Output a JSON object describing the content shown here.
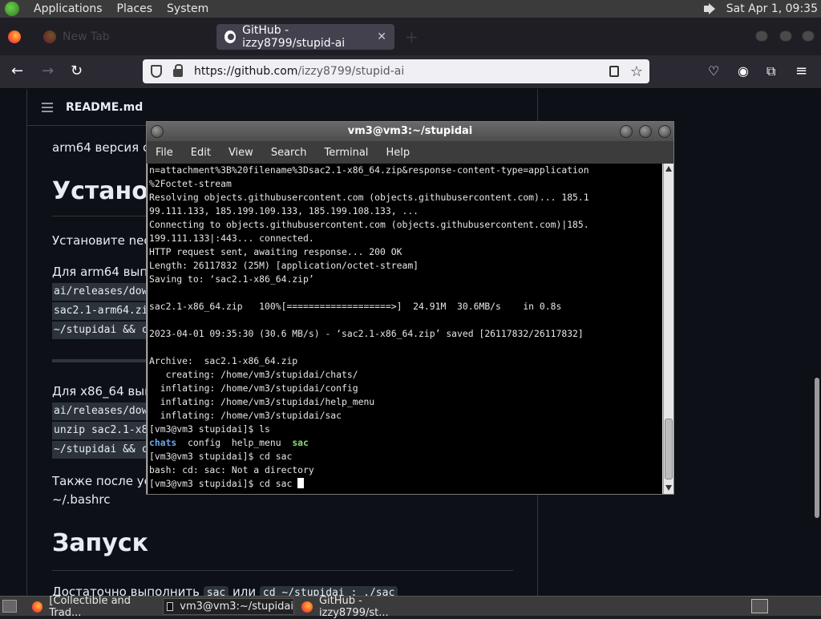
{
  "top_panel": {
    "menus": [
      "Applications",
      "Places",
      "System"
    ],
    "clock": "Sat Apr  1, 09:35"
  },
  "browser": {
    "tabs": [
      {
        "label": "",
        "active": false
      },
      {
        "label": "New Tab",
        "active": false
      },
      {
        "label": "GitHub - izzy8799/stupid-ai",
        "active": true
      }
    ],
    "url_host": "https://github.com",
    "url_path": "/izzy8799/stupid-ai"
  },
  "readme": {
    "header": "README.md",
    "p1": "arm64 версия со",
    "h_install": "Установ",
    "p_install": "Установите neof",
    "p_arm64": "Для arm64 выпо",
    "code_arm": [
      "ai/releases/dow",
      "sac2.1-arm64.zi",
      "~/stupidai && c"
    ],
    "p_x86": "Для x86_64 вып",
    "code_x86": [
      "ai/releases/dow",
      "unzip sac2.1-x8",
      "~/stupidai && c"
    ],
    "p_also": "Также после уст",
    "p_bashrc": "~/.bashrc",
    "h_run": "Запуск",
    "run_text_a": "Достаточно выполнить",
    "run_code_a": "sac",
    "run_text_b": "или",
    "run_code_b": "cd ~/stupidai ; ./sac"
  },
  "terminal": {
    "title": "vm3@vm3:~/stupidai",
    "menu": [
      "File",
      "Edit",
      "View",
      "Search",
      "Terminal",
      "Help"
    ],
    "lines": [
      "n=attachment%3B%20filename%3Dsac2.1-x86_64.zip&response-content-type=application",
      "%2Foctet-stream",
      "Resolving objects.githubusercontent.com (objects.githubusercontent.com)... 185.1",
      "99.111.133, 185.199.109.133, 185.199.108.133, ...",
      "Connecting to objects.githubusercontent.com (objects.githubusercontent.com)|185.",
      "199.111.133|:443... connected.",
      "HTTP request sent, awaiting response... 200 OK",
      "Length: 26117832 (25M) [application/octet-stream]",
      "Saving to: ‘sac2.1-x86_64.zip’",
      "",
      "sac2.1-x86_64.zip   100%[===================>]  24.91M  30.6MB/s    in 0.8s",
      "",
      "2023-04-01 09:35:30 (30.6 MB/s) - ‘sac2.1-x86_64.zip’ saved [26117832/26117832]",
      "",
      "Archive:  sac2.1-x86_64.zip",
      "   creating: /home/vm3/stupidai/chats/",
      "  inflating: /home/vm3/stupidai/config",
      "  inflating: /home/vm3/stupidai/help_menu",
      "  inflating: /home/vm3/stupidai/sac",
      "[vm3@vm3 stupidai]$ ls"
    ],
    "ls_dir": "chats",
    "ls_files": "  config  help_menu  ",
    "ls_exe": "sac",
    "after_ls": [
      "[vm3@vm3 stupidai]$ cd sac",
      "bash: cd: sac: Not a directory"
    ],
    "prompt_line": "[vm3@vm3 stupidai]$ cd sac "
  },
  "taskbar": {
    "items": [
      {
        "label": "[Collectible and Trad...",
        "icon": "firefox-icon",
        "active": false
      },
      {
        "label": "vm3@vm3:~/stupidai",
        "icon": "terminal-icon",
        "active": true
      },
      {
        "label": "GitHub - izzy8799/st...",
        "icon": "firefox-icon",
        "active": false
      }
    ]
  }
}
